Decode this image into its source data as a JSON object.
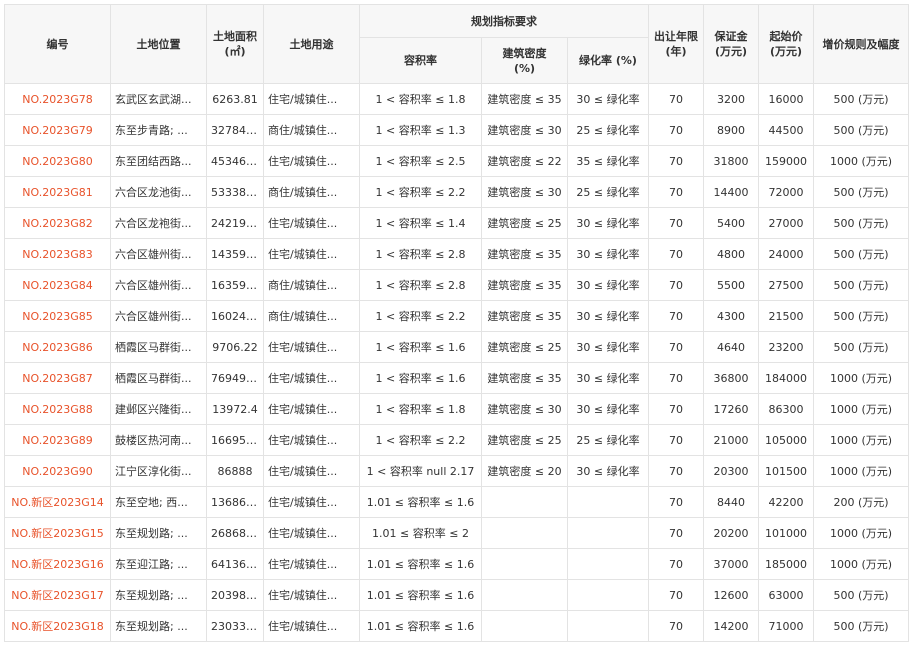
{
  "headers": {
    "id": "编号",
    "location": "土地位置",
    "area_l1": "土地面积",
    "area_l2": "(㎡)",
    "use": "土地用途",
    "plan": "规划指标要求",
    "far": "容积率",
    "density_l1": "建筑密度",
    "density_l2": "(%)",
    "green": "绿化率 (%)",
    "term_l1": "出让年限",
    "term_l2": "(年)",
    "deposit_l1": "保证金",
    "deposit_l2": "(万元)",
    "start_l1": "起始价",
    "start_l2": "(万元)",
    "increment": "增价规则及幅度"
  },
  "rows": [
    {
      "id": "NO.2023G78",
      "location": "玄武区玄武湖...",
      "area": "6263.81",
      "use": "住宅/城镇住...",
      "far": "1 < 容积率 ≤ 1.8",
      "density": "建筑密度 ≤ 35",
      "green": "30 ≤ 绿化率",
      "term": "70",
      "deposit": "3200",
      "start": "16000",
      "increment": "500 (万元)"
    },
    {
      "id": "NO.2023G79",
      "location": "东至步青路; ...",
      "area": "32784.11",
      "use": "商住/城镇住...",
      "far": "1 < 容积率 ≤ 1.3",
      "density": "建筑密度 ≤ 30",
      "green": "25 ≤ 绿化率",
      "term": "70",
      "deposit": "8900",
      "start": "44500",
      "increment": "500 (万元)"
    },
    {
      "id": "NO.2023G80",
      "location": "东至团结西路...",
      "area": "45346.48",
      "use": "住宅/城镇住...",
      "far": "1 < 容积率 ≤ 2.5",
      "density": "建筑密度 ≤ 22",
      "green": "35 ≤ 绿化率",
      "term": "70",
      "deposit": "31800",
      "start": "159000",
      "increment": "1000 (万元)"
    },
    {
      "id": "NO.2023G81",
      "location": "六合区龙池街...",
      "area": "53338.69",
      "use": "商住/城镇住...",
      "far": "1 < 容积率 ≤ 2.2",
      "density": "建筑密度 ≤ 30",
      "green": "25 ≤ 绿化率",
      "term": "70",
      "deposit": "14400",
      "start": "72000",
      "increment": "500 (万元)"
    },
    {
      "id": "NO.2023G82",
      "location": "六合区龙袍街...",
      "area": "24219.23",
      "use": "住宅/城镇住...",
      "far": "1 < 容积率 ≤ 1.4",
      "density": "建筑密度 ≤ 25",
      "green": "30 ≤ 绿化率",
      "term": "70",
      "deposit": "5400",
      "start": "27000",
      "increment": "500 (万元)"
    },
    {
      "id": "NO.2023G83",
      "location": "六合区雄州街...",
      "area": "14359.64",
      "use": "住宅/城镇住...",
      "far": "1 < 容积率 ≤ 2.8",
      "density": "建筑密度 ≤ 35",
      "green": "30 ≤ 绿化率",
      "term": "70",
      "deposit": "4800",
      "start": "24000",
      "increment": "500 (万元)"
    },
    {
      "id": "NO.2023G84",
      "location": "六合区雄州街...",
      "area": "16359.03",
      "use": "商住/城镇住...",
      "far": "1 < 容积率 ≤ 2.8",
      "density": "建筑密度 ≤ 35",
      "green": "30 ≤ 绿化率",
      "term": "70",
      "deposit": "5500",
      "start": "27500",
      "increment": "500 (万元)"
    },
    {
      "id": "NO.2023G85",
      "location": "六合区雄州街...",
      "area": "16024.69",
      "use": "商住/城镇住...",
      "far": "1 < 容积率 ≤ 2.2",
      "density": "建筑密度 ≤ 35",
      "green": "30 ≤ 绿化率",
      "term": "70",
      "deposit": "4300",
      "start": "21500",
      "increment": "500 (万元)"
    },
    {
      "id": "NO.2023G86",
      "location": "栖霞区马群街...",
      "area": "9706.22",
      "use": "住宅/城镇住...",
      "far": "1 < 容积率 ≤ 1.6",
      "density": "建筑密度 ≤ 25",
      "green": "30 ≤ 绿化率",
      "term": "70",
      "deposit": "4640",
      "start": "23200",
      "increment": "500 (万元)"
    },
    {
      "id": "NO.2023G87",
      "location": "栖霞区马群街...",
      "area": "76949.84",
      "use": "住宅/城镇住...",
      "far": "1 < 容积率 ≤ 1.6",
      "density": "建筑密度 ≤ 35",
      "green": "30 ≤ 绿化率",
      "term": "70",
      "deposit": "36800",
      "start": "184000",
      "increment": "1000 (万元)"
    },
    {
      "id": "NO.2023G88",
      "location": "建邺区兴隆街...",
      "area": "13972.4",
      "use": "住宅/城镇住...",
      "far": "1 < 容积率 ≤ 1.8",
      "density": "建筑密度 ≤ 30",
      "green": "30 ≤ 绿化率",
      "term": "70",
      "deposit": "17260",
      "start": "86300",
      "increment": "1000 (万元)"
    },
    {
      "id": "NO.2023G89",
      "location": "鼓楼区热河南...",
      "area": "16695.37",
      "use": "住宅/城镇住...",
      "far": "1 < 容积率 ≤ 2.2",
      "density": "建筑密度 ≤ 25",
      "green": "25 ≤ 绿化率",
      "term": "70",
      "deposit": "21000",
      "start": "105000",
      "increment": "1000 (万元)"
    },
    {
      "id": "NO.2023G90",
      "location": "江宁区淳化街...",
      "area": "86888",
      "use": "住宅/城镇住...",
      "far": "1 < 容积率 null 2.17",
      "density": "建筑密度 ≤ 20",
      "green": "30 ≤ 绿化率",
      "term": "70",
      "deposit": "20300",
      "start": "101500",
      "increment": "1000 (万元)"
    },
    {
      "id": "NO.新区2023G14",
      "location": "东至空地; 西...",
      "area": "13686.78",
      "use": "住宅/城镇住...",
      "far": "1.01 ≤ 容积率 ≤ 1.6",
      "density": "",
      "green": "",
      "term": "70",
      "deposit": "8440",
      "start": "42200",
      "increment": "200 (万元)"
    },
    {
      "id": "NO.新区2023G15",
      "location": "东至规划路; ...",
      "area": "26868.94",
      "use": "住宅/城镇住...",
      "far": "1.01 ≤ 容积率 ≤ 2",
      "density": "",
      "green": "",
      "term": "70",
      "deposit": "20200",
      "start": "101000",
      "increment": "1000 (万元)"
    },
    {
      "id": "NO.新区2023G16",
      "location": "东至迎江路; ...",
      "area": "64136.59",
      "use": "住宅/城镇住...",
      "far": "1.01 ≤ 容积率 ≤ 1.6",
      "density": "",
      "green": "",
      "term": "70",
      "deposit": "37000",
      "start": "185000",
      "increment": "1000 (万元)"
    },
    {
      "id": "NO.新区2023G17",
      "location": "东至规划路; ...",
      "area": "20398.55",
      "use": "住宅/城镇住...",
      "far": "1.01 ≤ 容积率 ≤ 1.6",
      "density": "",
      "green": "",
      "term": "70",
      "deposit": "12600",
      "start": "63000",
      "increment": "500 (万元)"
    },
    {
      "id": "NO.新区2023G18",
      "location": "东至规划路; ...",
      "area": "23033.36",
      "use": "住宅/城镇住...",
      "far": "1.01 ≤ 容积率 ≤ 1.6",
      "density": "",
      "green": "",
      "term": "70",
      "deposit": "14200",
      "start": "71000",
      "increment": "500 (万元)"
    }
  ]
}
